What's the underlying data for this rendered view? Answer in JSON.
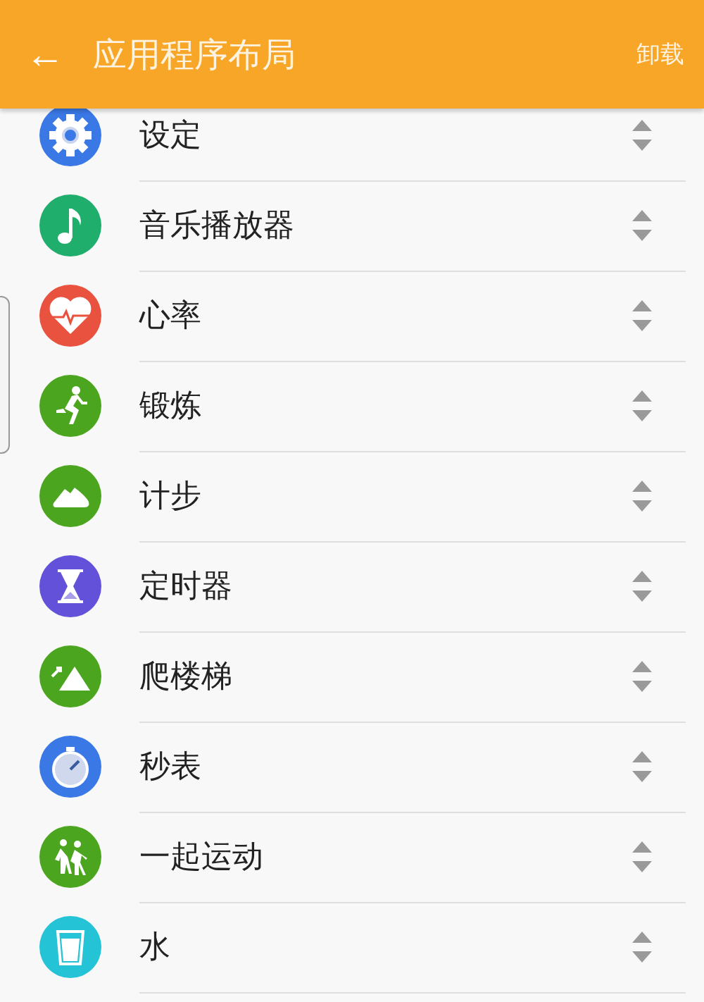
{
  "app_bar": {
    "back": "←",
    "title": "应用程序布局",
    "action": "卸载"
  },
  "apps": [
    {
      "name": "设定",
      "color": "#3a78e6"
    },
    {
      "name": "音乐播放器",
      "color": "#1fae6c"
    },
    {
      "name": "心率",
      "color": "#e8523f"
    },
    {
      "name": "锻炼",
      "color": "#4ca51f"
    },
    {
      "name": "计步",
      "color": "#4ca51f"
    },
    {
      "name": "定时器",
      "color": "#6351d9"
    },
    {
      "name": "爬楼梯",
      "color": "#4ca51f"
    },
    {
      "name": "秒表",
      "color": "#3a78e6"
    },
    {
      "name": "一起运动",
      "color": "#4ca51f"
    },
    {
      "name": "水",
      "color": "#25c3d6"
    }
  ]
}
